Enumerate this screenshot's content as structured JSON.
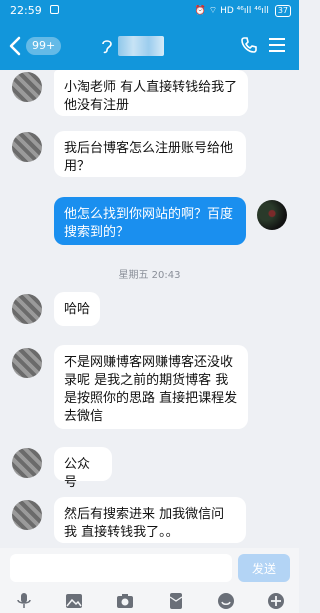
{
  "status_bar": {
    "time": "22:59",
    "indicators": "HD ⁴⁶ıll ⁴⁶ıll",
    "battery": "37"
  },
  "header": {
    "back_badge": "99+"
  },
  "messages": [
    {
      "side": "left",
      "text": "小淘老师 有人直接转钱给我了 他没有注册"
    },
    {
      "side": "left",
      "text": "我后台博客怎么注册账号给他用？"
    },
    {
      "side": "right",
      "text": "他怎么找到你网站的啊？百度搜索到的？"
    },
    {
      "side": "left",
      "text": "哈哈"
    },
    {
      "side": "left",
      "text": "不是网赚博客网赚博客还没收录呢 是我之前的期货博客  我是按照你的思路 直接把课程发去微信"
    },
    {
      "side": "left",
      "text": "公众号"
    },
    {
      "side": "left",
      "text": "然后有搜索进来 加我微信问我 直接转钱我了。。"
    }
  ],
  "timestamp": "星期五 20:43",
  "input": {
    "send_label": "发送"
  },
  "colors": {
    "brand": "#1296db",
    "self_bubble": "#1a8fef",
    "background": "#eef0f4"
  },
  "icons": [
    "back-icon",
    "ear-icon",
    "phone-icon",
    "menu-icon",
    "mic-icon",
    "image-icon",
    "camera-icon",
    "red-packet-icon",
    "emoji-icon",
    "plus-icon"
  ]
}
